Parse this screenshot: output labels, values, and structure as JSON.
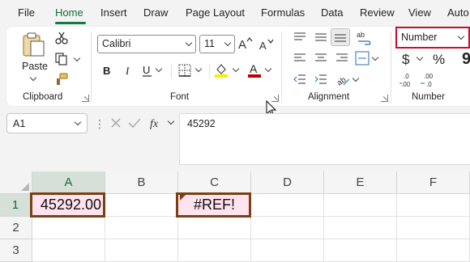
{
  "menu": {
    "tabs": [
      {
        "label": "File",
        "name": "tab-file"
      },
      {
        "label": "Home",
        "name": "tab-home"
      },
      {
        "label": "Insert",
        "name": "tab-insert"
      },
      {
        "label": "Draw",
        "name": "tab-draw"
      },
      {
        "label": "Page Layout",
        "name": "tab-page-layout"
      },
      {
        "label": "Formulas",
        "name": "tab-formulas"
      },
      {
        "label": "Data",
        "name": "tab-data"
      },
      {
        "label": "Review",
        "name": "tab-review"
      },
      {
        "label": "View",
        "name": "tab-view"
      },
      {
        "label": "Auto",
        "name": "tab-automate"
      }
    ],
    "active": "Home"
  },
  "ribbon": {
    "clipboard": {
      "group_label": "Clipboard",
      "paste_label": "Paste"
    },
    "font": {
      "group_label": "Font",
      "font_name": "Calibri",
      "font_size": "11"
    },
    "alignment": {
      "group_label": "Alignment"
    },
    "number": {
      "group_label": "Number",
      "format": "Number"
    }
  },
  "formula_bar": {
    "cell_ref": "A1",
    "formula": "45292"
  },
  "grid": {
    "columns": [
      "A",
      "B",
      "C",
      "D",
      "E",
      "F"
    ],
    "rows": [
      "1",
      "2",
      "3"
    ],
    "cells": {
      "A1": "45292.00",
      "C1": "#REF!"
    }
  },
  "colors": {
    "accent": "#107c41",
    "highlight_box": "#c8102e",
    "cell_outline": "#7b3f12",
    "cell_fill": "#ffe3ef"
  }
}
